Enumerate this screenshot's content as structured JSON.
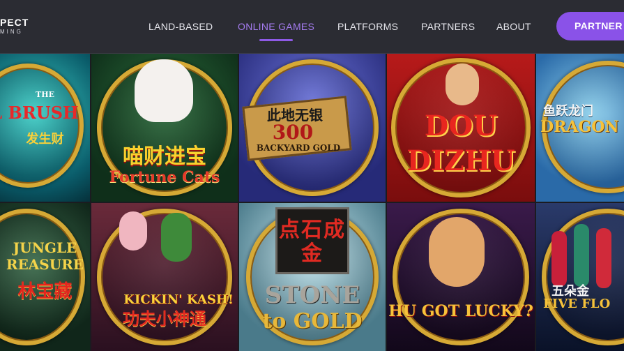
{
  "logo": {
    "main": "PECT",
    "sub": "MING"
  },
  "nav": {
    "links": [
      {
        "label": "LAND-BASED",
        "active": false
      },
      {
        "label": "ONLINE GAMES",
        "active": true
      },
      {
        "label": "PLATFORMS",
        "active": false
      },
      {
        "label": "PARTNERS",
        "active": false
      },
      {
        "label": "ABOUT",
        "active": false
      }
    ],
    "partner_button": "PARTNER"
  },
  "colors": {
    "accent": "#8a52e8",
    "active_text": "#a57cf0",
    "navbar": "#2b2c33",
    "gold": "#d6a935"
  },
  "games": [
    {
      "title_lines": [
        "THE",
        "L BRUSH"
      ],
      "cn": "发生财",
      "icon": "golden-brush-game-icon"
    },
    {
      "title_lines": [
        "Fortune Cats"
      ],
      "cn": "喵财进宝",
      "icon": "fortune-cats-game-icon"
    },
    {
      "title_lines": [
        "300",
        "BACKYARD GOLD"
      ],
      "cn": "此地无银",
      "icon": "backyard-gold-game-icon"
    },
    {
      "title_lines": [
        "DOU",
        "DIZHU"
      ],
      "cn": "",
      "icon": "dou-dizhu-game-icon"
    },
    {
      "title_lines": [
        "DRAGON"
      ],
      "cn": "鱼跃龙门",
      "icon": "dragon-game-icon"
    },
    {
      "title_lines": [
        "JUNGLE",
        "REASURE"
      ],
      "cn": "林宝藏",
      "icon": "jungle-treasure-game-icon"
    },
    {
      "title_lines": [
        "KICKIN' KASH!"
      ],
      "cn": "功夫小神通",
      "icon": "kickin-kash-game-icon"
    },
    {
      "title_lines": [
        "STONE",
        "to GOLD"
      ],
      "cn": "点石成金",
      "icon": "stone-to-gold-game-icon"
    },
    {
      "title_lines": [
        "HU GOT LUCKY?"
      ],
      "cn": "",
      "icon": "hu-got-lucky-game-icon"
    },
    {
      "title_lines": [
        "FIVE FLO"
      ],
      "cn": "五朵金",
      "icon": "five-flowers-game-icon"
    }
  ]
}
